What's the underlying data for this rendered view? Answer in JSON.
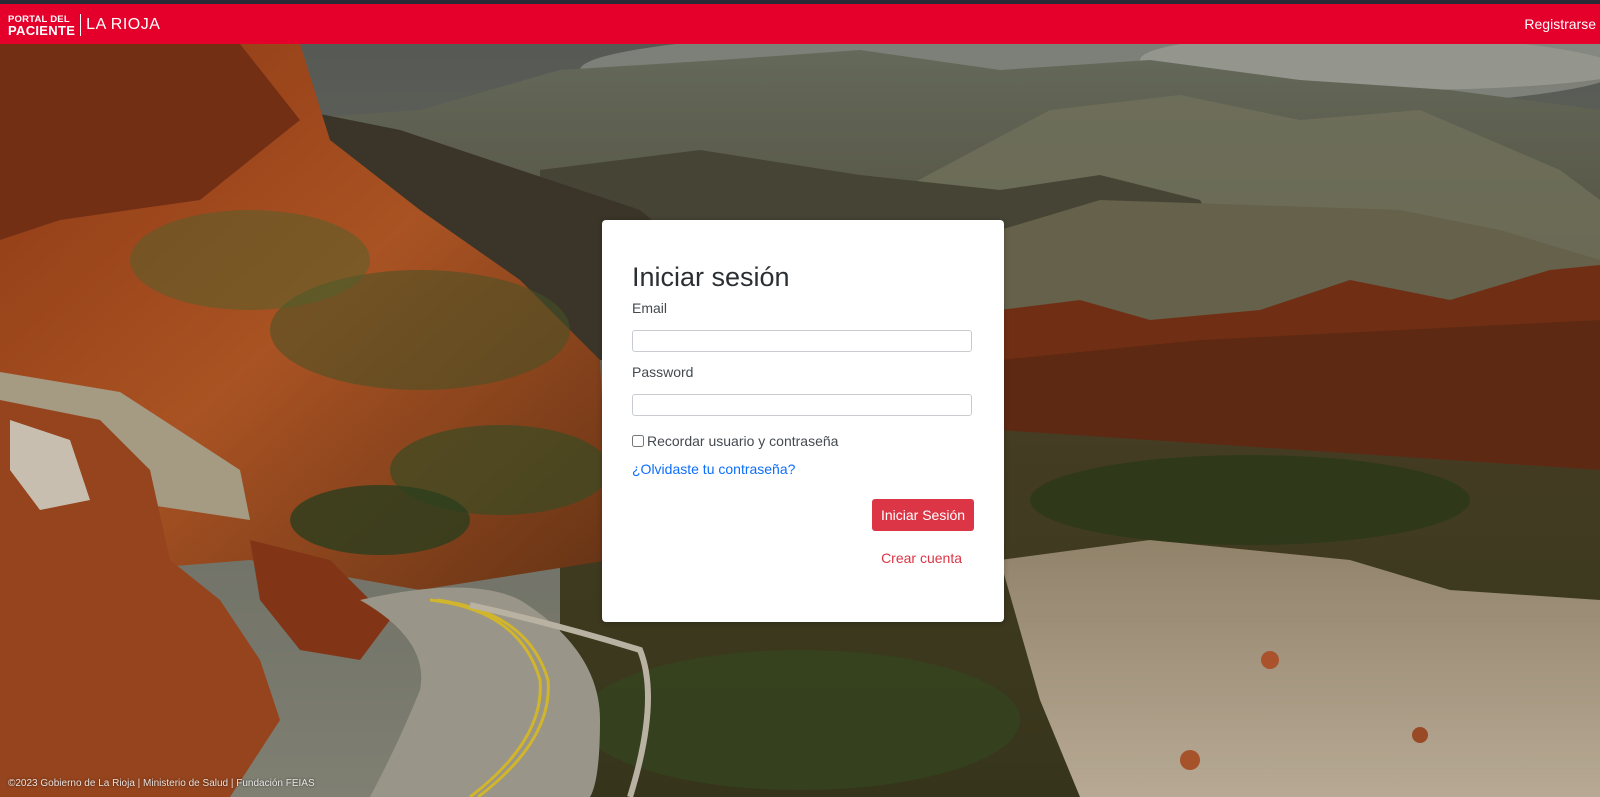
{
  "colors": {
    "navbar": "#e5002b",
    "primary_button": "#dc3545",
    "link": "#0d6efd",
    "create_link": "#dc3545"
  },
  "header": {
    "brand_line1": "PORTAL DEL",
    "brand_line2": "PACIENTE",
    "brand_region": "LA RIOJA",
    "register_label": "Registrarse"
  },
  "login": {
    "title": "Iniciar sesión",
    "email_label": "Email",
    "email_value": "",
    "password_label": "Password",
    "password_value": "",
    "remember_label": "Recordar usuario y contraseña",
    "remember_checked": false,
    "forgot_label": "¿Olvidaste tu contraseña?",
    "submit_label": "Iniciar Sesión",
    "create_account_label": "Crear cuenta"
  },
  "footer": {
    "text": "©2023 Gobierno de La Rioja | Ministerio de Salud | Fundación FEIAS"
  }
}
